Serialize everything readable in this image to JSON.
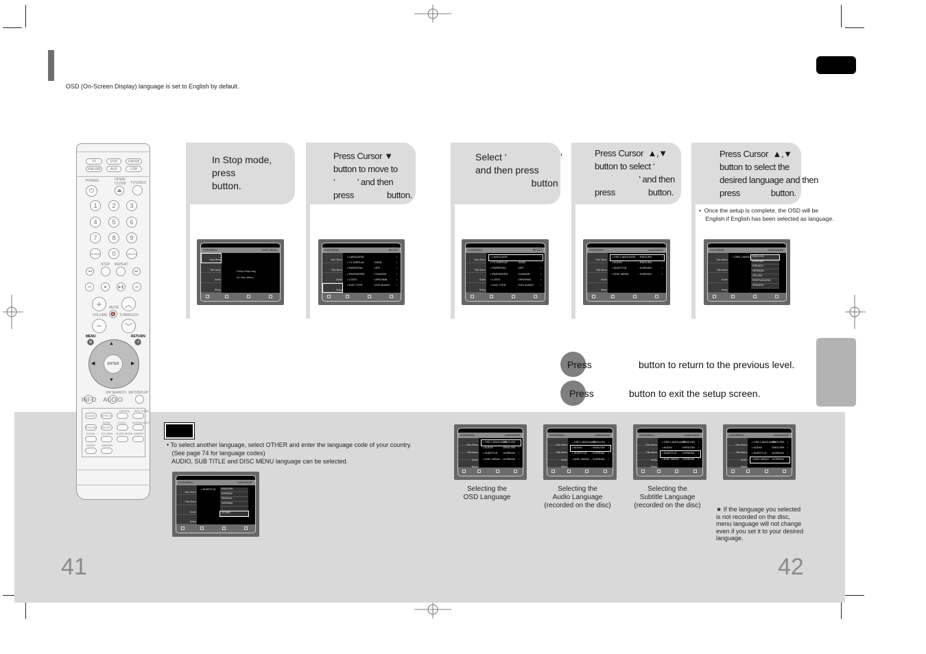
{
  "header": {
    "intro_note": "OSD  (On-Screen Display) language is set to English by default."
  },
  "steps": [
    {
      "text": "In Stop mode,\npress\nbutton."
    },
    {
      "text": "Press Cursor ▼\nbutton to move to\n‘          ’ and then\npress               button."
    },
    {
      "text": "Select ‘                    ’\nand then press\n                     button"
    },
    {
      "text": "Press Cursor  ▲,▼\nbutton to select ‘\n                    ’ and then\npress               button."
    },
    {
      "text": "Press Cursor  ▲,▼\nbutton to select the\ndesired language and then\npress              button."
    }
  ],
  "after_setup_note": "•  Once the setup is complete, the OSD will be\n    English if English has been selected as language.",
  "screens": {
    "disc_menu": {
      "left_title": "DVD/MENU",
      "right_title": "DISC MENU",
      "message": "Press Enter key\nfor Disc Menu",
      "sidebar": [
        "Disc Menu",
        "Title Menu",
        "Audio",
        "Setup"
      ]
    },
    "setup": {
      "left_title": "DVD/MENU",
      "right_title": "SETUP",
      "rows": [
        {
          "k": "• LANGUAGE",
          "v": "",
          "a": "›"
        },
        {
          "k": "• TV DISPLAY",
          "v": ": WIDE",
          "a": "›"
        },
        {
          "k": "• PARENTAL",
          "v": ": OFF",
          "a": "›"
        },
        {
          "k": "• PASSWORD",
          "v": ": CHANGE",
          "a": "›"
        },
        {
          "k": "• LOGO",
          "v": ": ORIGINAL",
          "a": "›"
        },
        {
          "k": "• DVD TYPE",
          "v": ": DVD AUDIO",
          "a": "›"
        }
      ]
    },
    "language": {
      "left_title": "DVD/MENU",
      "right_title": "LANGUAGE",
      "rows": [
        {
          "k": "• OSD LANGUAGE",
          "v": ": ENGLISH",
          "a": "›"
        },
        {
          "k": "• AUDIO",
          "v": ": ENGLISH",
          "a": "›"
        },
        {
          "k": "• SUBTITLE",
          "v": ": KOREAN",
          "a": "›"
        },
        {
          "k": "• DISC MENU",
          "v": ": KOREAN",
          "a": "›"
        }
      ]
    },
    "osd_list": {
      "label": "• OSD LANGUAGE",
      "options": [
        "ENGLISH",
        "KOREAN",
        "FRENCH",
        "GERMAN",
        "ITALIAN",
        "PORTUGUESE",
        "SPANISH"
      ]
    },
    "subtitle_list": {
      "label": "• SUBTITLE",
      "options": [
        "ENGLISH",
        "KOREAN",
        "FRENCH",
        "GERMAN",
        "⋮",
        "OTHER"
      ]
    }
  },
  "controls": {
    "return_line": {
      "press": "Press",
      "text": "button to return to the previous level."
    },
    "exit_line": {
      "press": "Press",
      "text": "button to exit the setup screen."
    }
  },
  "note": {
    "lines": [
      "• To select another language, select OTHER and enter the language code of your country.",
      "   (See page 74 for language codes)",
      "   AUDIO, SUB TITLE and DISC MENU language can be selected."
    ]
  },
  "captions": [
    "Selecting the\nOSD Language",
    "Selecting the\nAudio Language\n(recorded on the disc)",
    "Selecting the\nSubtitle Language\n(recorded on the disc)"
  ],
  "star_note": "★ If the language you selected is not recorded on the disc, menu language will not change even if you set it to your desired language.",
  "page_numbers": {
    "left": "41",
    "right": "42"
  },
  "remote": {
    "source_buttons": [
      "TV",
      "DVD",
      "FM/XM",
      "XM/USB",
      "AUX",
      "USB"
    ],
    "labels": {
      "power": "POWER",
      "open_close": "OPEN/ CLOSE",
      "tv_video": "TV/VIDEO",
      "step": "STEP",
      "repeat": "REPEAT",
      "mute": "MUTE",
      "volume": "VOLUME",
      "tuning": "TUNING/CH",
      "menu": "MENU",
      "return": "RETURN",
      "enter": "ENTER",
      "xm_search": "XM SEARCH",
      "xm_display": "XM DISPLAY"
    },
    "digits": [
      "1",
      "2",
      "3",
      "4",
      "5",
      "6",
      "7",
      "8",
      "9",
      "REMAIN",
      "0",
      "CANCEL"
    ],
    "function_labels": [
      "DSP/EQ",
      "TEST TONE",
      "SLOW",
      "LOGO",
      "SOUND EDIT",
      "ZOOM",
      "EZ VIEW",
      "SLIDE MODE",
      "DIGEST",
      "SLEEP",
      "DIMMER"
    ],
    "function_buttons": [
      "MODE",
      "EFFECT",
      "P.SCAN",
      "MO/ST",
      "INFO",
      "AUDIO"
    ]
  }
}
